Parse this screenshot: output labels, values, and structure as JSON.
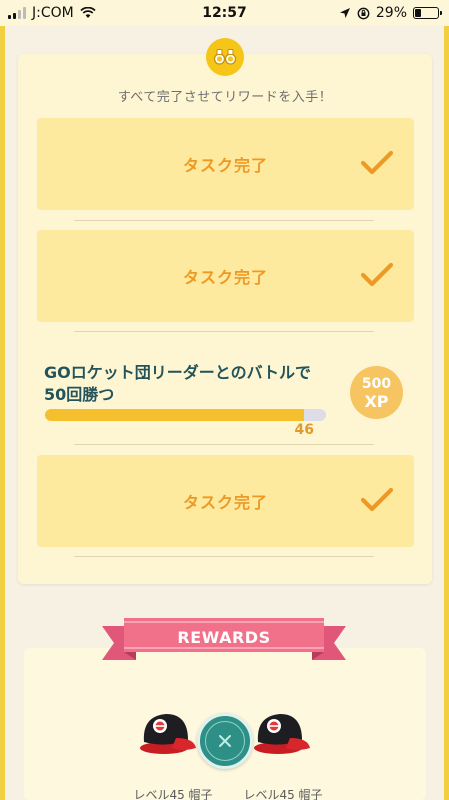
{
  "status_bar": {
    "carrier": "J:COM",
    "time": "12:57",
    "battery": "29%",
    "battery_level": 0.29
  },
  "colors": {
    "accent_yellow": "#f5c518",
    "task_bg": "#feea9e",
    "task_text": "#ec9a25",
    "banner_pink": "#f1718b",
    "close_teal": "#2d8f86"
  },
  "research": {
    "header_icon": "binoculars-icon",
    "instruction": "すべて完了させてリワードを入手！",
    "tasks": [
      {
        "label": "タスク完了",
        "icon": "checkmark-icon"
      },
      {
        "label": "タスク完了",
        "icon": "checkmark-icon"
      },
      {
        "label": "タスク完了",
        "icon": "checkmark-icon"
      }
    ],
    "active_task": {
      "title_line1": "GOロケット団リーダーとのバトルで",
      "title_line2": "50回勝つ",
      "progress_value": "46",
      "progress_fraction": 0.92,
      "xp_amount": "500",
      "xp_unit": "XP"
    }
  },
  "rewards": {
    "banner_label": "REWARDS",
    "items": [
      {
        "label": "レベル45 帽子",
        "icon": "cap-icon"
      },
      {
        "label": "レベル45 帽子",
        "icon": "cap-icon"
      }
    ],
    "close_icon": "close-icon"
  }
}
